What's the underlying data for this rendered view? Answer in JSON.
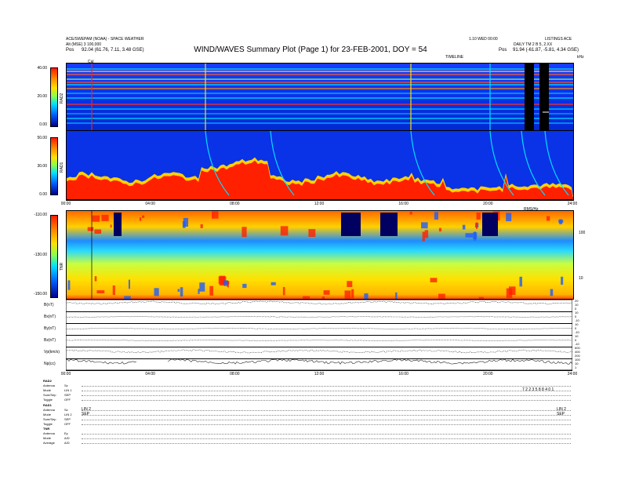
{
  "header": {
    "left_line1": "ACE/SWEPAM (NOAA) - SPACE WEATHER",
    "left_line2": "Alt (MSE) 3 100,000",
    "left_line3_label": "Pos",
    "left_line3_value": "92.04 (61.76, 7.11, 3.48 GSE)",
    "right_line1": "1.10 WED 00:00",
    "right_line1b": "LISTINGS ACE",
    "right_line2": "DAILY TM 2 B 5, 2.XX",
    "right_line3_label": "Pos",
    "right_line3_value": "91.94 (-61.87, -5.81, 4.34 GSE)",
    "center_small": "TIMELINE",
    "right_small": "kHz",
    "cal_label": "Cal"
  },
  "title": "WIND/WAVES Summary Plot (Page 1) for 23-FEB-2001, DOY = 54",
  "panels": {
    "rad2": {
      "label": "RAD2",
      "ticks": [
        "40.00",
        "20.00",
        "0.00"
      ]
    },
    "rad1": {
      "label": "RAD1",
      "ticks": [
        "50.00",
        "30.00",
        "0.00"
      ]
    },
    "tnr": {
      "label": "TNR",
      "ticks": [
        "-110.00",
        "-130.00",
        "-150.00"
      ],
      "right_ticks": [
        "100",
        "10"
      ],
      "right_small": "RMS/Hz"
    }
  },
  "time_axis": [
    "00:00",
    "04:00",
    "08:00",
    "12:00",
    "16:00",
    "20:00",
    "24:00"
  ],
  "mag_rows": [
    {
      "label": "B(nT)",
      "right": [
        "20",
        "10",
        "0"
      ]
    },
    {
      "label": "Bx(nT)",
      "right": [
        "10",
        "0",
        "-10"
      ]
    },
    {
      "label": "By(nT)",
      "right": [
        "10",
        "0",
        "-10"
      ]
    },
    {
      "label": "Bz(nT)",
      "right": [
        "10",
        "0",
        "-10"
      ]
    },
    {
      "label": "Vp(km/s)",
      "right": [
        "600",
        "400",
        "200"
      ]
    },
    {
      "label": "Np(cc)",
      "right": [
        "100",
        "10",
        "1"
      ]
    }
  ],
  "info": {
    "rad2_header": "RAD2",
    "rad2_lines": [
      {
        "k": "Antenna",
        "v": "Sz"
      },
      {
        "k": "Mode",
        "v": "LIN 1"
      },
      {
        "k": "Sum/Sep",
        "v": "SEP"
      },
      {
        "k": "Toggle",
        "v": "OFF"
      }
    ],
    "rad1_header": "RAD1",
    "rad1_lines": [
      {
        "k": "Antenna",
        "v": "Sz"
      },
      {
        "k": "Mode",
        "v": "LIN 2"
      },
      {
        "k": "Sum/Sep",
        "v": "SEP"
      },
      {
        "k": "Toggle",
        "v": "OFF"
      }
    ],
    "tnr_header": "TNR",
    "tnr_lines": [
      {
        "k": "Antenna",
        "v": "Ey"
      },
      {
        "k": "Mode",
        "v": "A/D"
      },
      {
        "k": "Average",
        "v": "A/D"
      }
    ],
    "right_code": "7 2 2 3 5 8 8 4 0 1",
    "mid_marks": [
      "LIN 2",
      "SEP"
    ],
    "right_marks": [
      "LIN 2",
      "SEP"
    ]
  },
  "chart_data": {
    "type": "heatmap",
    "title": "WIND/WAVES Summary Plot (Page 1) for 23-FEB-2001, DOY = 54",
    "x_ticks": [
      "00:00",
      "04:00",
      "08:00",
      "12:00",
      "16:00",
      "20:00",
      "24:00"
    ],
    "panels": [
      {
        "name": "RAD2",
        "color_scale": [
          0,
          40
        ],
        "colorbar_ticks": [
          40,
          20,
          0
        ]
      },
      {
        "name": "RAD1",
        "color_scale": [
          0,
          50
        ],
        "colorbar_ticks": [
          50,
          30,
          0
        ]
      },
      {
        "name": "TNR",
        "color_scale": [
          -150,
          -110
        ],
        "colorbar_ticks": [
          -110,
          -130,
          -150
        ]
      }
    ],
    "colors": {
      "low": "#00008c",
      "mid_low": "#0060ff",
      "mid": "#00e0ff",
      "mid_high": "#ffe000",
      "high": "#ff1a00"
    }
  }
}
